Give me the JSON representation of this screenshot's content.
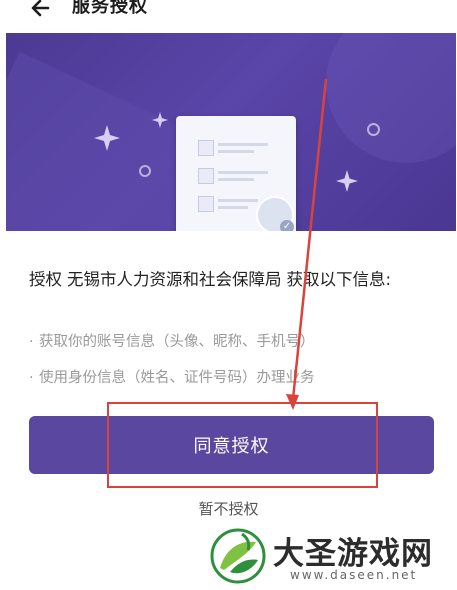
{
  "header": {
    "title": "服务授权",
    "back_icon": "back-arrow-icon"
  },
  "hero": {
    "icons": [
      "sparkle-icon",
      "ring-icon",
      "document-card-icon",
      "user-verified-icon"
    ]
  },
  "authorization": {
    "prefix": "授权",
    "organization": "无锡市人力资源和社会保障局",
    "suffix": "获取以下信息:",
    "permissions": [
      "获取你的账号信息（头像、昵称、手机号）",
      "使用身份信息（姓名、证件号码）办理业务"
    ]
  },
  "actions": {
    "agree_label": "同意授权",
    "deny_label": "暂不授权"
  },
  "annotation": {
    "color": "#d8443c"
  },
  "watermark": {
    "title": "大圣游戏网",
    "url": "www.daseen.net"
  },
  "colors": {
    "primary": "#5a48a0",
    "hero": "#4b3a93",
    "annotation": "#d8443c"
  }
}
